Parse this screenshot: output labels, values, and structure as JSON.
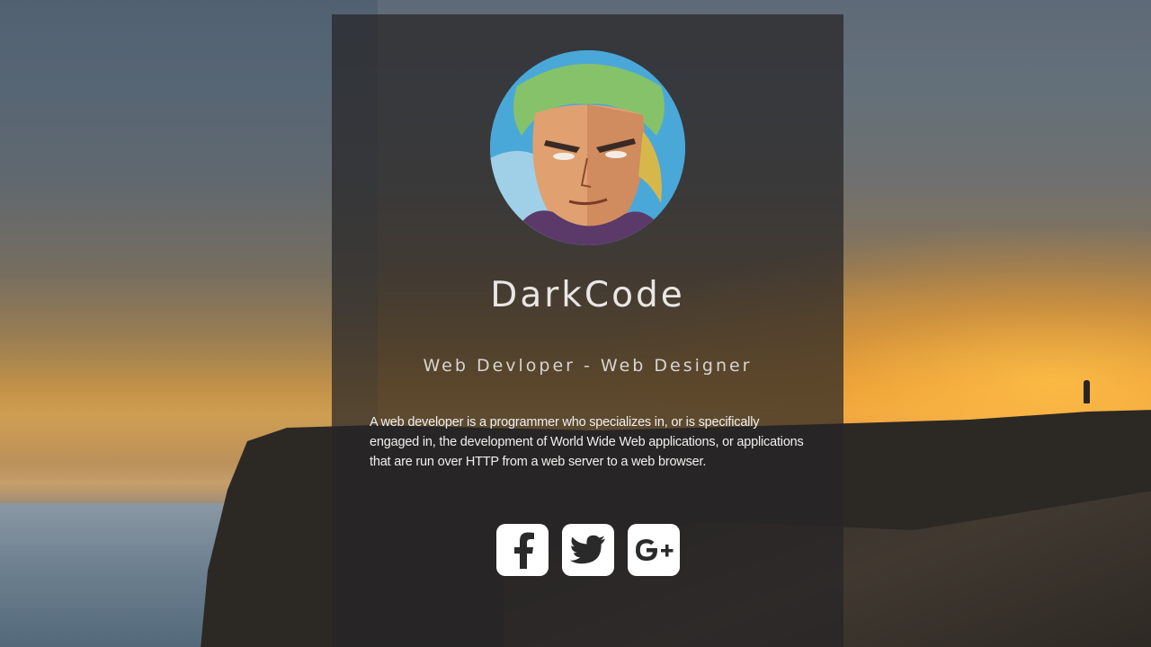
{
  "profile": {
    "name": "DarkCode",
    "role": "Web Devloper - Web Designer",
    "bio": "A web developer is a programmer who specializes in, or is specifically engaged in, the development of World Wide Web applications, or applications that are run over HTTP from a web server to a web browser."
  },
  "social": [
    {
      "icon": "facebook-icon"
    },
    {
      "icon": "twitter-icon"
    },
    {
      "icon": "google-plus-icon"
    }
  ],
  "colors": {
    "card_overlay": "#262426",
    "text": "#e9e6e4",
    "icon_tile": "#ffffff",
    "icon_glyph": "#2a2a2a"
  }
}
